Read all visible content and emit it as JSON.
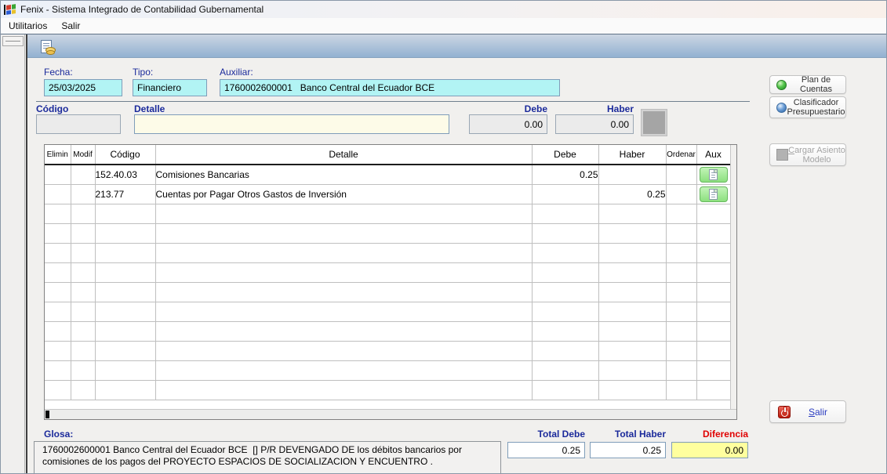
{
  "window": {
    "title": "Fenix - Sistema Integrado de Contabilidad Gubernamental"
  },
  "menu": {
    "utilitarios": "Utilitarios",
    "salir": "Salir"
  },
  "header_form": {
    "fecha_label": "Fecha:",
    "fecha_value": "25/03/2025",
    "tipo_label": "Tipo:",
    "tipo_value": "Financiero",
    "auxiliar_label": "Auxiliar:",
    "auxiliar_value": "1760002600001   Banco Central del Ecuador BCE"
  },
  "entry_form": {
    "codigo_label": "Código",
    "codigo_value": "",
    "detalle_label": "Detalle",
    "detalle_value": "",
    "debe_label": "Debe",
    "debe_value": "0.00",
    "haber_label": "Haber",
    "haber_value": "0.00"
  },
  "table": {
    "headers": [
      "Elimin",
      "Modif",
      "Código",
      "Detalle",
      "Debe",
      "Haber",
      "Ordenar",
      "Aux"
    ],
    "rows": [
      {
        "codigo": "152.40.03",
        "detalle": "Comisiones Bancarias",
        "debe": "0.25",
        "haber": ""
      },
      {
        "codigo": "213.77",
        "detalle": "Cuentas por Pagar Otros Gastos de Inversión",
        "debe": "",
        "haber": "0.25"
      }
    ]
  },
  "side_panel": {
    "plan_de_cuentas": "Plan de Cuentas",
    "clasificador_line1": "Clasificador",
    "clasificador_line2": "Presupuestario",
    "cargar_first": "C",
    "cargar_rest": "argar Asiento",
    "cargar_line2": "Modelo",
    "salir_first": "S",
    "salir_rest": "alir"
  },
  "footer": {
    "glosa_label": "Glosa:",
    "glosa_text": "1760002600001 Banco Central del Ecuador BCE  [] P/R DEVENGADO DE los débitos bancarios por comisiones de los pagos del PROYECTO ESPACIOS DE SOCIALIZACION Y ENCUENTRO .",
    "total_debe_label": "Total Debe",
    "total_debe_value": "0.25",
    "total_haber_label": "Total Haber",
    "total_haber_value": "0.25",
    "diferencia_label": "Diferencia",
    "diferencia_value": "0.00"
  },
  "colors": {
    "field_cyan": "#b2f4f4",
    "field_ivory": "#fdfbe8",
    "field_disabled": "#ebebeb",
    "diferencia_yellow": "#ffff9e",
    "label_navy": "#1b2a9b",
    "diferencia_red": "#e00000",
    "aux_button_green": "#8ce07e",
    "toolbar_blue_top": "#ccd6e3",
    "toolbar_blue_bottom": "#92b1d1"
  }
}
